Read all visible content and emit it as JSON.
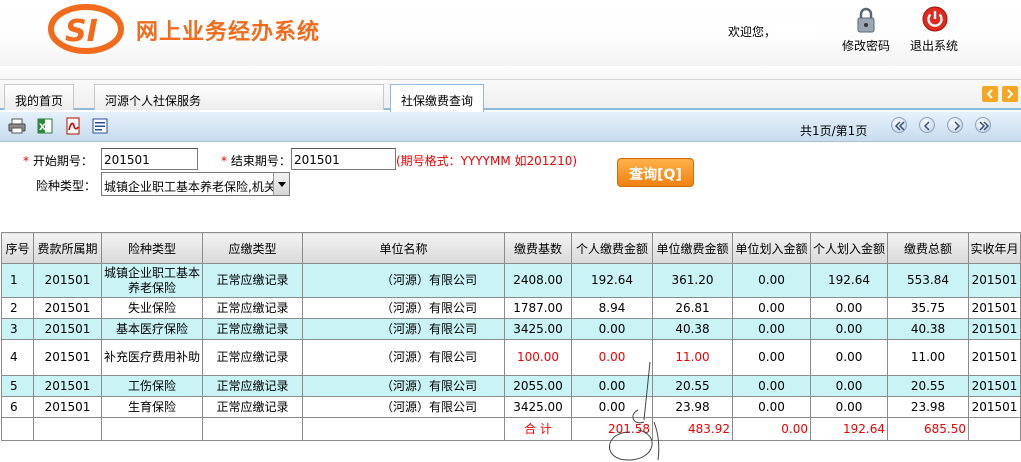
{
  "header": {
    "app_title": "网上业务经办系统",
    "welcome": "欢迎您，",
    "change_password_label": "修改密码",
    "logout_label": "退出系统",
    "brand_color": "#f26a1b"
  },
  "tabs": [
    {
      "label": "我的首页"
    },
    {
      "label": "河源个人社保服务"
    },
    {
      "label": "社保缴费查询"
    }
  ],
  "toolbar": {
    "icons": [
      "print-icon",
      "excel-icon",
      "pdf-icon",
      "word-icon"
    ],
    "page_info": "共1页/第1页"
  },
  "form": {
    "start_label": "开始期号：",
    "start_value": "201501",
    "end_label": "结束期号：",
    "end_value": "201501",
    "format_hint": "(期号格式：YYYYMM  如201210)",
    "insurance_type_label": "险种类型：",
    "insurance_type_value": "城镇企业职工基本养老保险,机关",
    "query_button": "查询[Q]"
  },
  "table": {
    "headers": [
      "序号",
      "费款所属期",
      "险种类型",
      "应缴类型",
      "单位名称",
      "缴费基数",
      "个人缴费金额",
      "单位缴费金额",
      "单位划入金额",
      "个人划入金额",
      "缴费总额",
      "实收年月"
    ],
    "rows": [
      {
        "no": "1",
        "period": "201501",
        "type": "城镇企业职工基本养老保险",
        "due_type": "正常应缴记录",
        "unit": "（河源）有限公司",
        "base": "2408.00",
        "personal": "192.64",
        "company": "361.20",
        "unit_transfer": "0.00",
        "personal_transfer": "192.64",
        "total": "553.84",
        "received": "201501"
      },
      {
        "no": "2",
        "period": "201501",
        "type": "失业保险",
        "due_type": "正常应缴记录",
        "unit": "（河源）有限公司",
        "base": "1787.00",
        "personal": "8.94",
        "company": "26.81",
        "unit_transfer": "0.00",
        "personal_transfer": "0.00",
        "total": "35.75",
        "received": "201501"
      },
      {
        "no": "3",
        "period": "201501",
        "type": "基本医疗保险",
        "due_type": "正常应缴记录",
        "unit": "（河源）有限公司",
        "base": "3425.00",
        "personal": "0.00",
        "company": "40.38",
        "unit_transfer": "0.00",
        "personal_transfer": "0.00",
        "total": "40.38",
        "received": "201501"
      },
      {
        "no": "4",
        "period": "201501",
        "type": "补充医疗费用补助",
        "due_type": "正常应缴记录",
        "unit": "（河源）有限公司",
        "base": "100.00",
        "personal": "0.00",
        "company": "11.00",
        "unit_transfer": "0.00",
        "personal_transfer": "0.00",
        "total": "11.00",
        "received": "201501"
      },
      {
        "no": "5",
        "period": "201501",
        "type": "工伤保险",
        "due_type": "正常应缴记录",
        "unit": "（河源）有限公司",
        "base": "2055.00",
        "personal": "0.00",
        "company": "20.55",
        "unit_transfer": "0.00",
        "personal_transfer": "0.00",
        "total": "20.55",
        "received": "201501"
      },
      {
        "no": "6",
        "period": "201501",
        "type": "生育保险",
        "due_type": "正常应缴记录",
        "unit": "（河源）有限公司",
        "base": "3425.00",
        "personal": "0.00",
        "company": "23.98",
        "unit_transfer": "0.00",
        "personal_transfer": "0.00",
        "total": "23.98",
        "received": "201501"
      }
    ],
    "total_row": {
      "label": "合  计",
      "personal": "201.58",
      "company": "483.92",
      "unit_transfer": "0.00",
      "personal_transfer": "192.64",
      "total": "685.50"
    }
  }
}
